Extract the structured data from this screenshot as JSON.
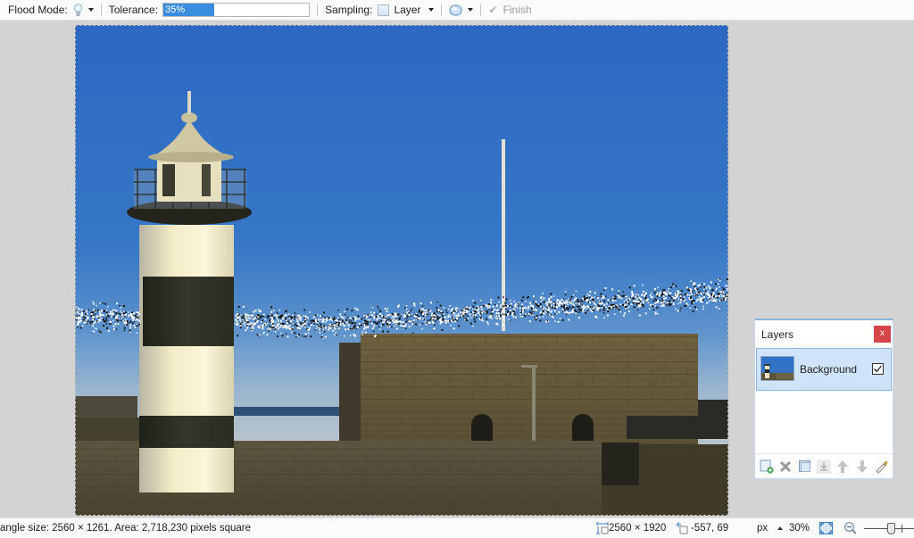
{
  "toolbar": {
    "flood_mode_label": "Flood Mode:",
    "flood_mode_icon": "lightbulb-icon",
    "tolerance_label": "Tolerance:",
    "tolerance_value": "35%",
    "tolerance_percent": 35,
    "sampling_label": "Sampling:",
    "sampling_value": "Layer",
    "selection_mode_icon": "selection-mode-icon",
    "finish_label": "Finish",
    "finish_icon": "checkmark-icon"
  },
  "canvas": {
    "description": "Lighthouse and stone fort under blue sky with magic wand selection active"
  },
  "layers_panel": {
    "title": "Layers",
    "close_label": "x",
    "layers": [
      {
        "name": "Background",
        "visible": true,
        "selected": true
      }
    ],
    "tools": [
      {
        "name": "add-layer-icon",
        "glyph": "+"
      },
      {
        "name": "delete-layer-icon",
        "glyph": "✖"
      },
      {
        "name": "duplicate-layer-icon",
        "glyph": "❐"
      },
      {
        "name": "merge-layer-down-icon",
        "glyph": "⇣"
      },
      {
        "name": "move-layer-up-icon",
        "glyph": "⬆"
      },
      {
        "name": "move-layer-down-icon",
        "glyph": "⬇"
      },
      {
        "name": "layer-properties-icon",
        "glyph": "✎"
      }
    ]
  },
  "statusbar": {
    "selection_info": "angle size: 2560 × 1261. Area: 2,718,230 pixels square",
    "image_size": "2560 × 1920",
    "cursor_position": "-557, 69",
    "units": "px",
    "zoom": "30%"
  },
  "colors": {
    "sky": "#2f6fc0",
    "accent": "#3a8ee0",
    "close_button": "#d6454a",
    "layer_selected": "#cfe4fa",
    "workspace": "#d3d3d3"
  }
}
